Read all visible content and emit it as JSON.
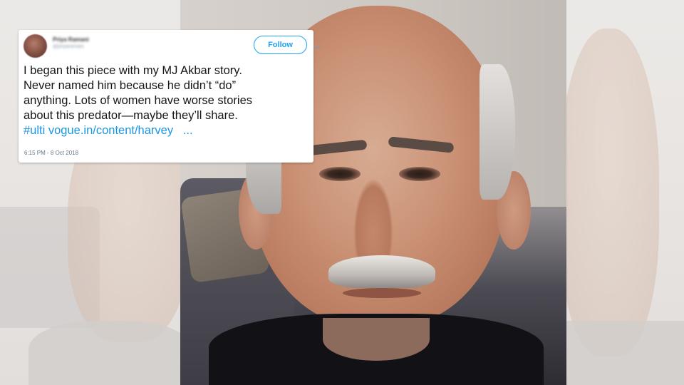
{
  "tweet": {
    "display_name": "Priya Ramani",
    "handle": "@priyaramani",
    "follow_label": "Follow",
    "lines": [
      "I began this piece with my MJ Akbar story.",
      "Never named him because he didn’t “do”",
      "anything. Lots of women have worse stories",
      "about this predator—maybe they’ll share."
    ],
    "hashtag": "#ulti",
    "link_text": "vogue.in/content/harvey",
    "ellipsis": "...",
    "timestamp": "6:15 PM - 8 Oct 2018"
  },
  "colors": {
    "accent": "#1da1f2",
    "link": "#1b95e0",
    "text": "#14171a",
    "muted": "#657786"
  },
  "icons": {
    "caret": "chevron-down-icon",
    "avatar": "avatar"
  }
}
